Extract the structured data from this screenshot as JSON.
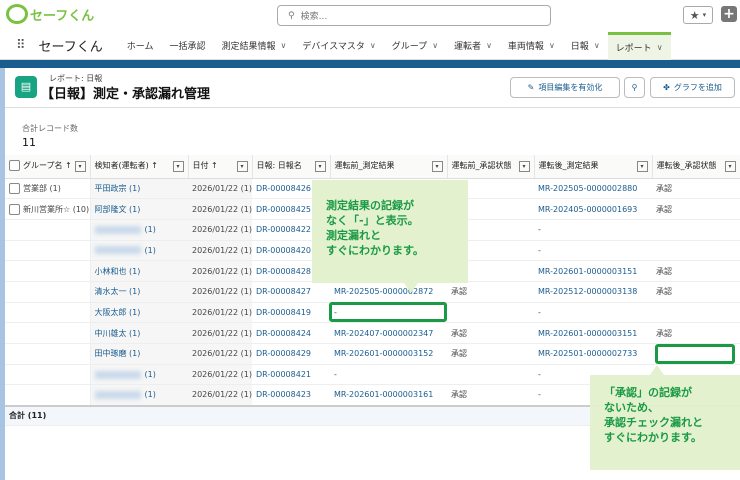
{
  "brand": {
    "logo_text": "セーフくん",
    "app_name": "セーフくん"
  },
  "search": {
    "placeholder": "検索..."
  },
  "nav": {
    "items": [
      {
        "label": "ホーム",
        "chevron": false
      },
      {
        "label": "一括承認",
        "chevron": false
      },
      {
        "label": "測定結果情報",
        "chevron": true
      },
      {
        "label": "デバイスマスタ",
        "chevron": true
      },
      {
        "label": "グループ",
        "chevron": true
      },
      {
        "label": "運転者",
        "chevron": true
      },
      {
        "label": "車両情報",
        "chevron": true
      },
      {
        "label": "日報",
        "chevron": true
      },
      {
        "label": "レポート",
        "chevron": true,
        "active": true
      }
    ]
  },
  "report": {
    "breadcrumb": "レポート: 日報",
    "title": "【日報】測定・承認漏れ管理",
    "edit_button": "項目編集を有効化",
    "chart_button": "グラフを追加"
  },
  "summary": {
    "label": "合計レコード数",
    "value": "11"
  },
  "table": {
    "columns": [
      "グループ名 ↑",
      "検知者(運転者) ↑",
      "日付 ↑",
      "日報: 日報名",
      "運転前_測定結果",
      "運転前_承認状態",
      "運転後_測定結果",
      "運転後_承認状態"
    ],
    "rows": [
      {
        "group": "営業部 (1)",
        "detector": "平田政宗 (1)",
        "blurred": false,
        "date": "2026/01/22 (1)",
        "report": "DR-00008426",
        "pre_result": "",
        "pre_status": "",
        "post_result": "MR-202505-0000002880",
        "post_status": "承認"
      },
      {
        "group": "新川営業所☆ (10)",
        "detector": "阿部隆文 (1)",
        "blurred": false,
        "date": "2026/01/22 (1)",
        "report": "DR-00008425",
        "pre_result": "",
        "pre_status": "",
        "post_result": "MR-202405-0000001693",
        "post_status": "承認"
      },
      {
        "group": "",
        "detector": "(1)",
        "blurred": true,
        "date": "2026/01/22 (1)",
        "report": "DR-00008422",
        "pre_result": "",
        "pre_status": "",
        "post_result": "-",
        "post_status": ""
      },
      {
        "group": "",
        "detector": "(1)",
        "blurred": true,
        "date": "2026/01/22 (1)",
        "report": "DR-00008420",
        "pre_result": "",
        "pre_status": "",
        "post_result": "-",
        "post_status": ""
      },
      {
        "group": "",
        "detector": "小林和也 (1)",
        "blurred": false,
        "date": "2026/01/22 (1)",
        "report": "DR-00008428",
        "pre_result": "",
        "pre_status": "",
        "post_result": "MR-202601-0000003151",
        "post_status": "承認"
      },
      {
        "group": "",
        "detector": "清水太一 (1)",
        "blurred": false,
        "date": "2026/01/22 (1)",
        "report": "DR-00008427",
        "pre_result": "MR-202505-0000002872",
        "pre_status": "承認",
        "post_result": "MR-202512-0000003138",
        "post_status": "承認"
      },
      {
        "group": "",
        "detector": "大阪太郎 (1)",
        "blurred": false,
        "date": "2026/01/22 (1)",
        "report": "DR-00008419",
        "pre_result": "-",
        "pre_status": "",
        "post_result": "-",
        "post_status": ""
      },
      {
        "group": "",
        "detector": "中川雄太 (1)",
        "blurred": false,
        "date": "2026/01/22 (1)",
        "report": "DR-00008424",
        "pre_result": "MR-202407-0000002347",
        "pre_status": "承認",
        "post_result": "MR-202601-0000003151",
        "post_status": "承認"
      },
      {
        "group": "",
        "detector": "田中琢磨 (1)",
        "blurred": false,
        "date": "2026/01/22 (1)",
        "report": "DR-00008429",
        "pre_result": "MR-202601-0000003152",
        "pre_status": "承認",
        "post_result": "MR-202501-0000002733",
        "post_status": ""
      },
      {
        "group": "",
        "detector": "(1)",
        "blurred": true,
        "date": "2026/01/22 (1)",
        "report": "DR-00008421",
        "pre_result": "-",
        "pre_status": "",
        "post_result": "-",
        "post_status": ""
      },
      {
        "group": "",
        "detector": "(1)",
        "blurred": true,
        "date": "2026/01/22 (1)",
        "report": "DR-00008423",
        "pre_result": "MR-202601-0000003161",
        "pre_status": "承認",
        "post_result": "-",
        "post_status": ""
      }
    ],
    "total_label": "合計 (11)"
  },
  "annotations": {
    "callout1": [
      "測定結果の記録が",
      "なく「-」と表示。",
      "測定漏れと",
      "すぐにわかります。"
    ],
    "callout2": [
      "「承認」の記録が",
      "ないため、",
      "承認チェック漏れと",
      "すぐにわかります。"
    ],
    "accent": "#1a9a45"
  }
}
